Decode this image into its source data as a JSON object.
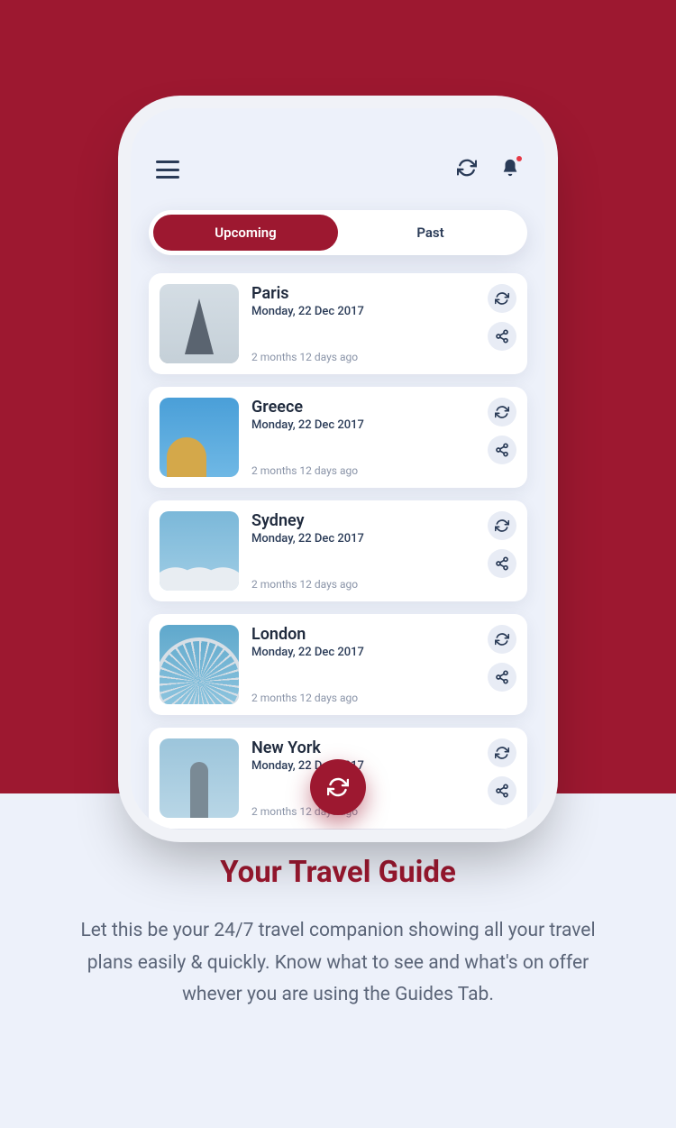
{
  "tabs": {
    "upcoming": "Upcoming",
    "past": "Past"
  },
  "trips": [
    {
      "id": "paris",
      "title": "Paris",
      "date": "Monday, 22 Dec 2017",
      "ago": "2 months 12 days ago"
    },
    {
      "id": "greece",
      "title": "Greece",
      "date": "Monday, 22 Dec 2017",
      "ago": "2 months 12 days ago"
    },
    {
      "id": "sydney",
      "title": "Sydney",
      "date": "Monday, 22 Dec 2017",
      "ago": "2 months 12 days ago"
    },
    {
      "id": "london",
      "title": "London",
      "date": "Monday, 22 Dec 2017",
      "ago": "2 months 12 days ago"
    },
    {
      "id": "ny",
      "title": "New York",
      "date": "Monday, 22 Dec 2017",
      "ago": "2 months 12 days ago"
    }
  ],
  "promo": {
    "title": "Your Travel Guide",
    "body": "Let this be your 24/7 travel companion showing all your travel plans easily & quickly. Know what to see and what's on offer whever you are using the Guides Tab."
  }
}
